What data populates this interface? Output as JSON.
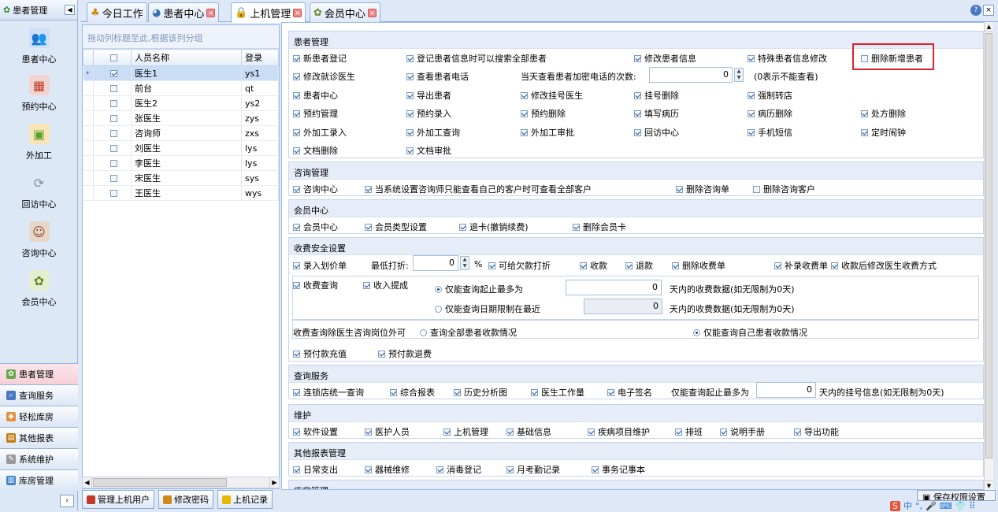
{
  "nav": {
    "header": "患者管理",
    "big_items": [
      "患者中心",
      "预约中心",
      "外加工",
      "回访中心",
      "咨询中心",
      "会员中心"
    ],
    "small_items": [
      "患者管理",
      "查询服务",
      "轻松库房",
      "其他报表",
      "系统维护",
      "库房管理"
    ]
  },
  "tabs": [
    "今日工作",
    "患者中心",
    "上机管理",
    "会员中心"
  ],
  "grid": {
    "group_hint": "拖动列标题至此,根据该列分组",
    "headers": [
      "人员名称",
      "登录"
    ],
    "rows": [
      {
        "name": "医生1",
        "login": "ys1",
        "checked": true
      },
      {
        "name": "前台",
        "login": "qt",
        "checked": false
      },
      {
        "name": "医生2",
        "login": "ys2",
        "checked": false
      },
      {
        "name": "张医生",
        "login": "zys",
        "checked": false
      },
      {
        "name": "咨询师",
        "login": "zxs",
        "checked": false
      },
      {
        "name": "刘医生",
        "login": "lys",
        "checked": false
      },
      {
        "name": "李医生",
        "login": "lys",
        "checked": false
      },
      {
        "name": "宋医生",
        "login": "sys",
        "checked": false
      },
      {
        "name": "王医生",
        "login": "wys",
        "checked": false
      }
    ]
  },
  "bottom_buttons": [
    "管理上机用户",
    "修改密码",
    "上机记录"
  ],
  "sections": {
    "patient": "患者管理",
    "consult": "咨询管理",
    "member": "会员中心",
    "fee": "收费安全设置",
    "query": "查询服务",
    "maintain": "维护",
    "other": "其他报表管理",
    "store": "库房管理"
  },
  "perm": {
    "p1": [
      "新患者登记",
      "登记患者信息时可以搜索全部患者",
      "修改患者信息",
      "特殊患者信息修改",
      "删除新增患者"
    ],
    "p2a": [
      "修改就诊医生",
      "查看患者电话"
    ],
    "phone_count_label": "当天查看患者加密电话的次数:",
    "phone_count": "0",
    "phone_count_note": "(0表示不能查看)",
    "p3": [
      "患者中心",
      "导出患者",
      "修改挂号医生",
      "挂号删除",
      "强制转店"
    ],
    "p4": [
      "预约管理",
      "预约录入",
      "预约删除",
      "填写病历",
      "病历删除",
      "处方删除"
    ],
    "p5": [
      "外加工录入",
      "外加工查询",
      "外加工审批",
      "回访中心",
      "手机短信",
      "定时闹钟"
    ],
    "p6": [
      "文档删除",
      "文档审批"
    ],
    "c1": [
      "咨询中心",
      "当系统设置咨询师只能查看自己的客户时可查看全部客户",
      "删除咨询单",
      "删除咨询客户"
    ],
    "m1": [
      "会员中心",
      "会员类型设置",
      "退卡(撤销续费)",
      "删除会员卡"
    ],
    "f1a": "录入划价单",
    "min_discount_label": "最低打折:",
    "min_discount": "0",
    "percent": "%",
    "f1b": [
      "可给欠款打折",
      "收款",
      "退款",
      "删除收费单",
      "补录收费单",
      "收款后修改医生收费方式"
    ],
    "f2": [
      "收费查询",
      "收入提成"
    ],
    "f2r1": "仅能查询起止最多为",
    "f2r1v": "0",
    "f2r1t": "天内的收费数据(如无限制为0天)",
    "f2r2": "仅能查询日期限制在最近",
    "f2r2v": "0",
    "f2r2t": "天内的收费数据(如无限制为0天)",
    "f3label": "收费查询除医生咨询岗位外可",
    "f3a": "查询全部患者收款情况",
    "f3b": "仅能查询自己患者收款情况",
    "f4": [
      "预付款充值",
      "预付款退费"
    ],
    "q1": [
      "连锁店统一查询",
      "综合报表",
      "历史分析图",
      "医生工作量",
      "电子签名"
    ],
    "q1label": "仅能查询起止最多为",
    "q1v": "0",
    "q1t": "天内的挂号信息(如无限制为0天)",
    "w1": [
      "软件设置",
      "医护人员",
      "上机管理",
      "基础信息",
      "疾病项目维护",
      "排班",
      "说明手册",
      "导出功能"
    ],
    "o1": [
      "日常支出",
      "器械维修",
      "消毒登记",
      "月考勤记录",
      "事务记事本"
    ]
  },
  "save_button": "保存权限设置",
  "ime": "中"
}
